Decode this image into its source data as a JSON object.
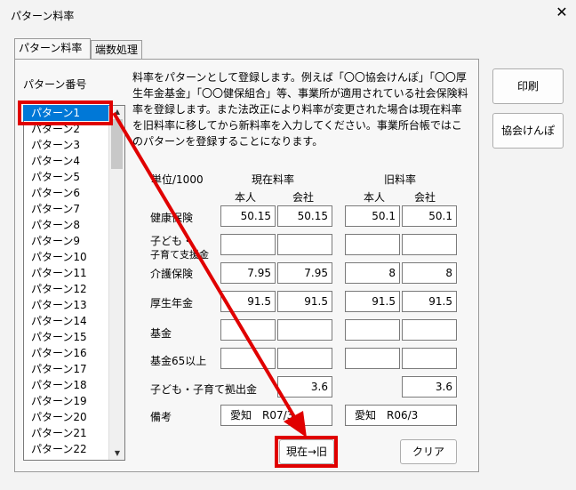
{
  "window": {
    "title": "パターン料率",
    "close": "✕"
  },
  "tabs": [
    {
      "label": "パターン料率"
    },
    {
      "label": "端数処理"
    }
  ],
  "pattern_label": "パターン番号",
  "patterns": [
    "パターン1",
    "パターン2",
    "パターン3",
    "パターン4",
    "パターン5",
    "パターン6",
    "パターン7",
    "パターン8",
    "パターン9",
    "パターン10",
    "パターン11",
    "パターン12",
    "パターン13",
    "パターン14",
    "パターン15",
    "パターン16",
    "パターン17",
    "パターン18",
    "パターン19",
    "パターン20",
    "パターン21",
    "パターン22"
  ],
  "description": "料率をパターンとして登録します。例えば「〇〇協会けんぽ」「〇〇厚生年金基金」「〇〇健保組合」等、事業所が適用されている社会保険料率を登録します。また法改正により料率が変更された場合は現在料率を旧料率に移してから新料率を入力してください。事業所台帳ではこのパターンを登録することになります。",
  "headers": {
    "unit": "単位/1000",
    "current": "現在料率",
    "old": "旧料率",
    "self": "本人",
    "company": "会社"
  },
  "rows": {
    "kenko": {
      "label": "健康保険",
      "cur_self": "50.15",
      "cur_co": "50.15",
      "old_self": "50.1",
      "old_co": "50.1"
    },
    "kodomo": {
      "label1": "子ども・",
      "label2": "子育て支援金",
      "cur_self": "",
      "cur_co": "",
      "old_self": "",
      "old_co": ""
    },
    "kaigo": {
      "label": "介護保険",
      "cur_self": "7.95",
      "cur_co": "7.95",
      "old_self": "8",
      "old_co": "8"
    },
    "kosei": {
      "label": "厚生年金",
      "cur_self": "91.5",
      "cur_co": "91.5",
      "old_self": "91.5",
      "old_co": "91.5"
    },
    "kikin": {
      "label": "基金",
      "cur_self": "",
      "cur_co": "",
      "old_self": "",
      "old_co": ""
    },
    "kikin65": {
      "label": "基金65以上",
      "cur_self": "",
      "cur_co": "",
      "old_self": "",
      "old_co": ""
    },
    "kyoshutsu": {
      "label": "子ども・子育て拠出金",
      "cur_co": "3.6",
      "old_co": "3.6"
    },
    "biko": {
      "label": "備考",
      "cur": "愛知　R07/3",
      "old": "愛知　R06/3"
    }
  },
  "buttons": {
    "print": "印刷",
    "kyokai": "協会けんぽ",
    "copy": "現在→旧",
    "clear": "クリア"
  },
  "scroll": {
    "up": "▲",
    "down": "▼"
  },
  "colors": {
    "annotation": "#e00000",
    "selection": "#0078d7"
  }
}
